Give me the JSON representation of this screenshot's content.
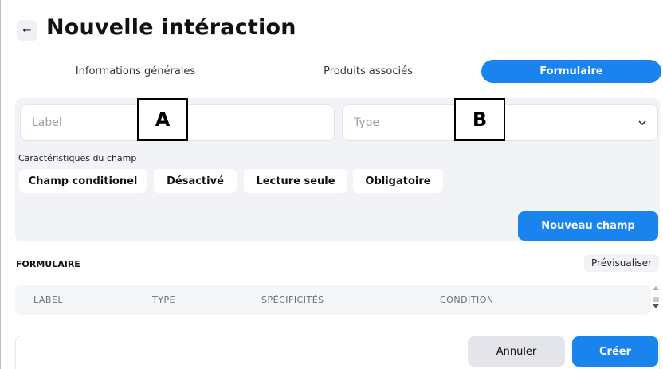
{
  "header": {
    "back_icon": "←",
    "title": "Nouvelle intéraction"
  },
  "tabs": [
    {
      "label": "Informations générales",
      "active": false
    },
    {
      "label": "Produits associés",
      "active": false
    },
    {
      "label": "Formulaire",
      "active": true
    }
  ],
  "form_builder": {
    "label_placeholder": "Label",
    "type_placeholder": "Type",
    "type_chevron": "⌵",
    "overlay_a": "A",
    "overlay_b": "B",
    "characteristics_label": "Caractéristiques du champ",
    "chips": [
      "Champ conditionel",
      "Désactivé",
      "Lecture seule",
      "Obligatoire"
    ],
    "new_field_button": "Nouveau champ"
  },
  "formulaire": {
    "title": "FORMULAIRE",
    "preview_button": "Prévisualiser",
    "columns": [
      "LABEL",
      "TYPE",
      "SPÉCIFICITÉS",
      "CONDITION"
    ]
  },
  "footer": {
    "cancel_label": "Annuler",
    "create_label": "Créer"
  },
  "colors": {
    "accent": "#1a84ee",
    "panel_bg": "#f1f3f6"
  }
}
